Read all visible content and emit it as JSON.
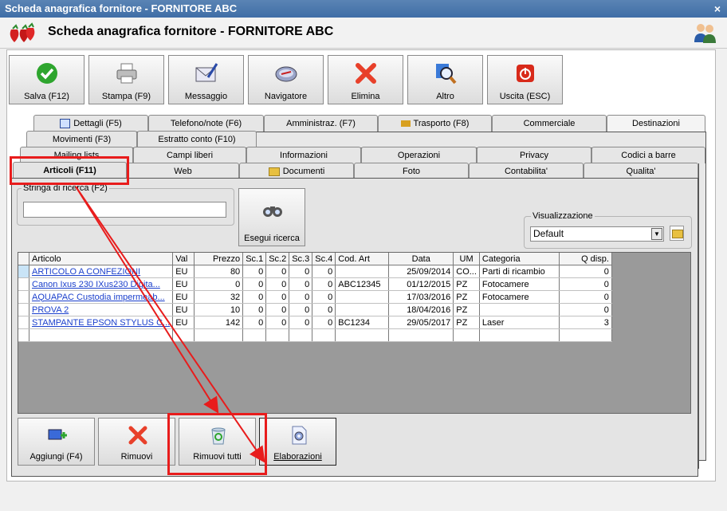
{
  "window": {
    "title": "Scheda anagrafica fornitore - FORNITORE ABC",
    "close": "×"
  },
  "header": {
    "title": "Scheda anagrafica fornitore - FORNITORE ABC"
  },
  "toolbar": [
    {
      "label": "Salva (F12)",
      "icon": "check-icon"
    },
    {
      "label": "Stampa (F9)",
      "icon": "printer-icon"
    },
    {
      "label": "Messaggio",
      "icon": "envelope-icon"
    },
    {
      "label": "Navigatore",
      "icon": "compass-icon"
    },
    {
      "label": "Elimina",
      "icon": "x-icon"
    },
    {
      "label": "Altro",
      "icon": "magnifier-icon"
    },
    {
      "label": "Uscita (ESC)",
      "icon": "power-icon"
    }
  ],
  "tabs_row1": [
    "Dettagli (F5)",
    "Telefono/note (F6)",
    "Amministraz. (F7)",
    "Trasporto (F8)",
    "Commerciale",
    "Destinazioni"
  ],
  "tabs_row2": [
    "Movimenti (F3)",
    "Estratto conto (F10)"
  ],
  "tabs_row3": [
    "Mailing lists",
    "Campi liberi",
    "Informazioni",
    "Operazioni",
    "Privacy",
    "Codici a barre"
  ],
  "tabs_row4": [
    "Articoli (F11)",
    "Web",
    "Documenti",
    "Foto",
    "Contabilita'",
    "Qualita'"
  ],
  "search": {
    "label": "Stringa di ricerca (F2)",
    "value": "",
    "button": "Esegui ricerca"
  },
  "view": {
    "label": "Visualizzazione",
    "selected": "Default"
  },
  "table": {
    "columns": [
      "Articolo",
      "Val",
      "Prezzo",
      "Sc.1",
      "Sc.2",
      "Sc.3",
      "Sc.4",
      "Cod. Art",
      "Data",
      "UM",
      "Categoria",
      "Q disp."
    ],
    "rows": [
      [
        "ARTICOLO A CONFEZIONI",
        "EU",
        "80",
        "0",
        "0",
        "0",
        "0",
        "",
        "25/09/2014",
        "CO...",
        "Parti di ricambio",
        "0"
      ],
      [
        "Canon Ixus 230 IXus230 Digita...",
        "EU",
        "0",
        "0",
        "0",
        "0",
        "0",
        "ABC12345",
        "01/12/2015",
        "PZ",
        "Fotocamere",
        "0"
      ],
      [
        "AQUAPAC Custodia impermeab...",
        "EU",
        "32",
        "0",
        "0",
        "0",
        "0",
        "",
        "17/03/2016",
        "PZ",
        "Fotocamere",
        "0"
      ],
      [
        "PROVA 2",
        "EU",
        "10",
        "0",
        "0",
        "0",
        "0",
        "",
        "18/04/2016",
        "PZ",
        "",
        "0"
      ],
      [
        "STAMPANTE EPSON STYLUS C...",
        "EU",
        "142",
        "0",
        "0",
        "0",
        "0",
        "BC1234",
        "29/05/2017",
        "PZ",
        "Laser",
        "3"
      ]
    ]
  },
  "bottom_buttons": [
    {
      "label": "Aggiungi (F4)",
      "icon": "add-icon"
    },
    {
      "label": "Rimuovi",
      "icon": "x-icon"
    },
    {
      "label": "Rimuovi tutti",
      "icon": "recycle-bin-icon"
    },
    {
      "label": "Elaborazioni",
      "icon": "gear-document-icon"
    }
  ],
  "colors": {
    "highlight": "#e81c1c",
    "link": "#1a3fcc",
    "titlebar": "#4a78ae"
  }
}
